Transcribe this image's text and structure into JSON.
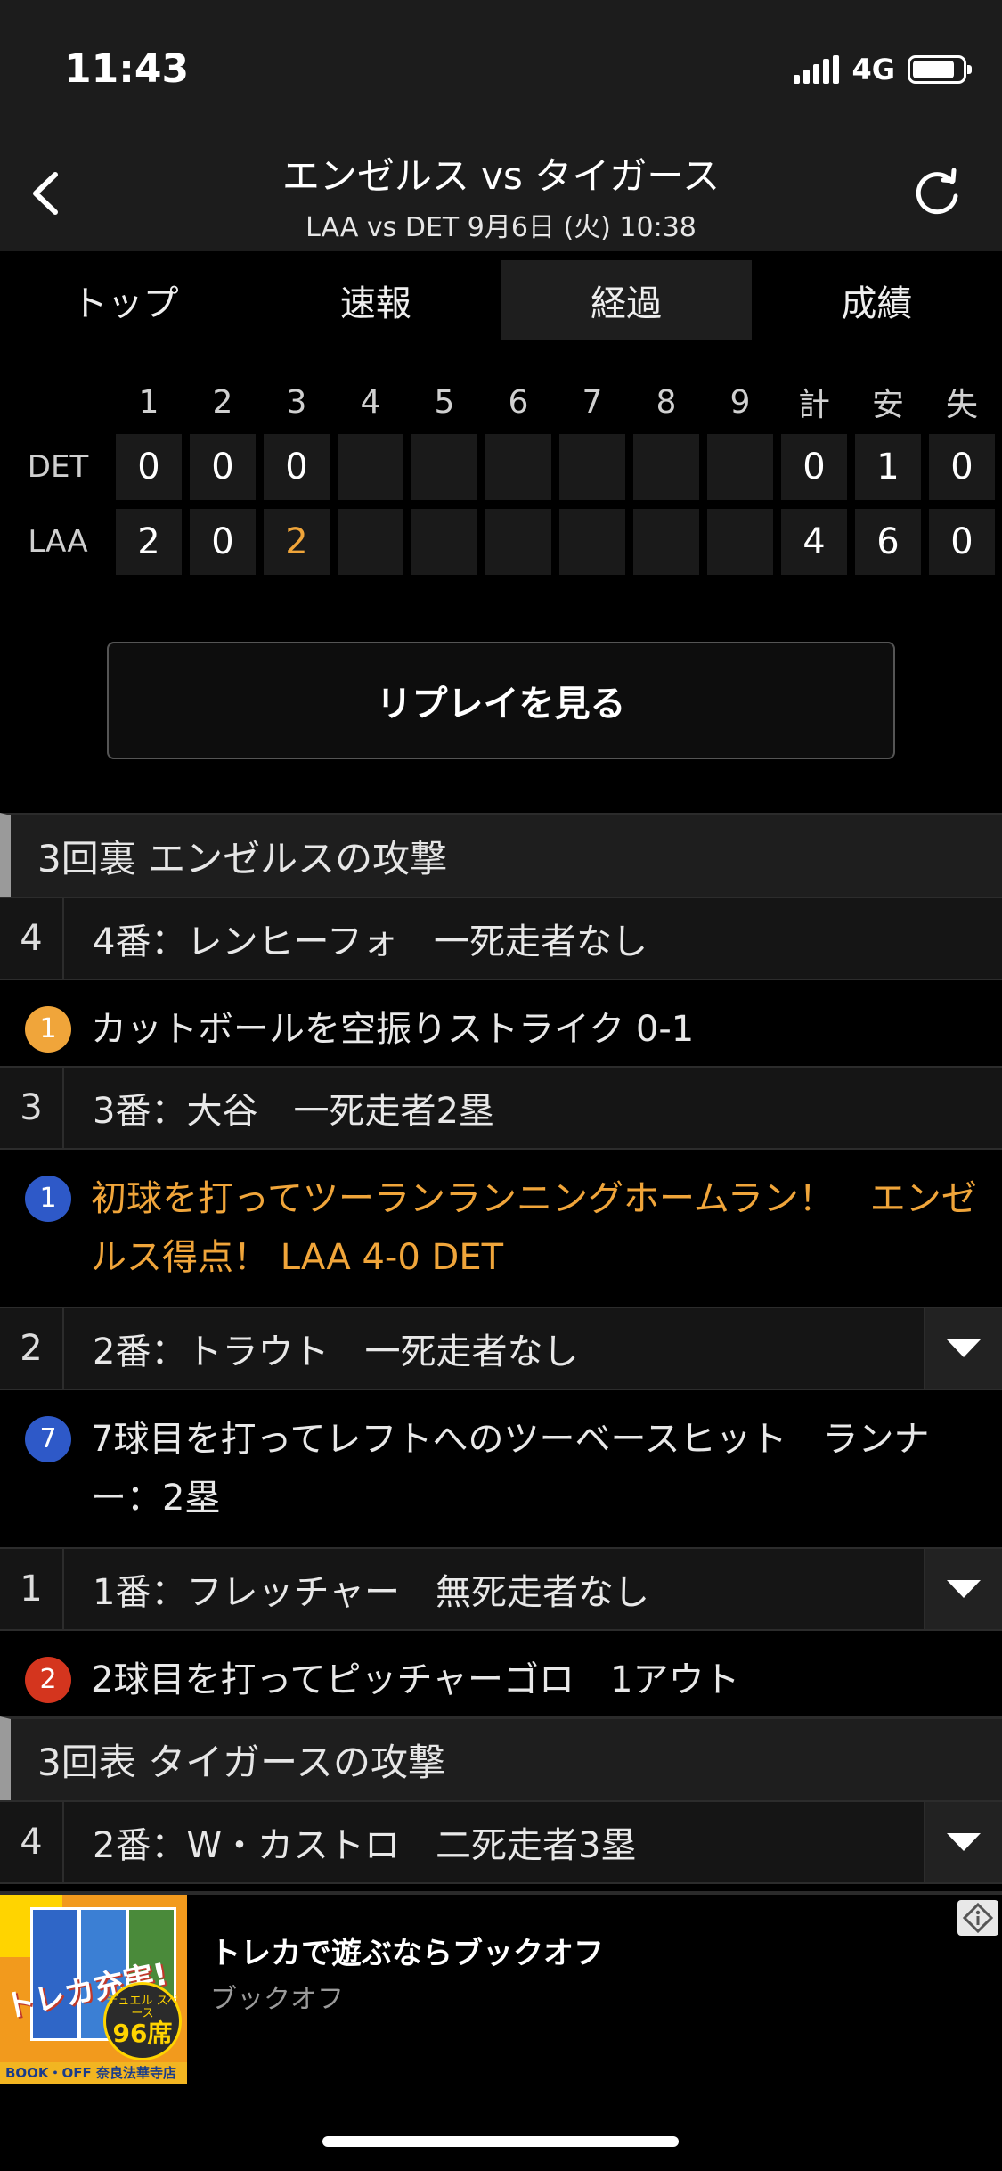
{
  "status": {
    "time": "11:43",
    "network": "4G"
  },
  "header": {
    "title": "エンゼルス vs タイガース",
    "subtitle": "LAA vs DET 9月6日 (火) 10:38"
  },
  "tabs": [
    {
      "label": "トップ",
      "active": false
    },
    {
      "label": "速報",
      "active": false
    },
    {
      "label": "経過",
      "active": true
    },
    {
      "label": "成績",
      "active": false
    }
  ],
  "scoreboard": {
    "columns": [
      "1",
      "2",
      "3",
      "4",
      "5",
      "6",
      "7",
      "8",
      "9",
      "計",
      "安",
      "失"
    ],
    "rows": [
      {
        "team": "DET",
        "cells": [
          "0",
          "0",
          "0",
          "",
          "",
          "",
          "",
          "",
          "",
          "0",
          "1",
          "0"
        ]
      },
      {
        "team": "LAA",
        "cells": [
          "2",
          "0",
          "2",
          "",
          "",
          "",
          "",
          "",
          "",
          "4",
          "6",
          "0"
        ]
      }
    ]
  },
  "replay_button": "リプレイを見る",
  "play_by_play": {
    "inning_3_bottom": "3回裏 エンゼルスの攻撃",
    "b1": {
      "num": "4",
      "label": "4番：レンヒーフォ　一死走者なし"
    },
    "p1": {
      "badge": "1",
      "text": "カットボールを空振りストライク 0-1"
    },
    "b2": {
      "num": "3",
      "label": "3番：大谷　一死走者2塁"
    },
    "p2": {
      "badge": "1",
      "text": "初球を打ってツーランランニングホームラン！　エンゼルス得点！ LAA 4-0 DET"
    },
    "b3": {
      "num": "2",
      "label": "2番：トラウト　一死走者なし"
    },
    "p3": {
      "badge": "7",
      "text": "7球目を打ってレフトへのツーベースヒット　ランナー：2塁"
    },
    "b4": {
      "num": "1",
      "label": "1番：フレッチャー　無死走者なし"
    },
    "p4": {
      "badge": "2",
      "text": "2球目を打ってピッチャーゴロ　1アウト"
    },
    "inning_3_top": "3回表 タイガースの攻撃",
    "b5": {
      "num": "4",
      "label": "2番：W・カストロ　二死走者3塁"
    }
  },
  "ad": {
    "title": "トレカで遊ぶならブックオフ",
    "advertiser": "ブックオフ",
    "image_text": "トレカ充実!",
    "seal_top": "デュエル スペース",
    "seal_num": "96席",
    "footer": "BOOK・OFF 奈良法華寺店"
  },
  "colors": {
    "badge_yellow": "#f0a53a",
    "badge_blue": "#2e59c8",
    "badge_red": "#d4351e",
    "highlight_text": "#f0a53a"
  }
}
